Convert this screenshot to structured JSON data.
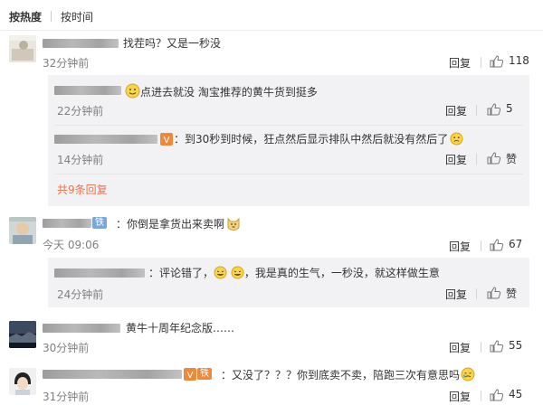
{
  "sort": {
    "hot": "按热度",
    "time": "按时间"
  },
  "comments": [
    {
      "text": "找茬吗？又是一秒没",
      "time": "32分钟前",
      "reply": "回复",
      "likes": "118",
      "replies": [
        {
          "text": "点进去就没 淘宝推荐的黄牛货到挺多",
          "time": "22分钟前",
          "reply": "回复",
          "likes": "5"
        },
        {
          "text": "：到30秒到时候，狂点然后显示排队中然后就没有然后了",
          "time": "14分钟前",
          "reply": "回复",
          "likes": "赞"
        }
      ],
      "more": "共9条回复"
    },
    {
      "badge": "铁粉",
      "text": "：你倒是拿货出来卖啊",
      "time": "今天 09:06",
      "reply": "回复",
      "likes": "67",
      "replies": [
        {
          "text": "：评论错了，",
          "text2": "，我是真的生气，一秒没，就这样做生意",
          "time": "24分钟前",
          "reply": "回复",
          "likes": "赞"
        }
      ]
    },
    {
      "text": "黄牛十周年纪念版……",
      "time": "30分钟前",
      "reply": "回复",
      "likes": "55"
    },
    {
      "badge": "铁粉",
      "text": "：又没了？？？你到底卖不卖，陪跑三次有意思吗",
      "time": "31分钟前",
      "reply": "回复",
      "likes": "45"
    }
  ],
  "colors": {
    "link": "#eb7350",
    "box": "#f2f2f5",
    "time": "#808080",
    "fan_badge": "#7aa6dc",
    "orange_badge": "#f0883c"
  }
}
